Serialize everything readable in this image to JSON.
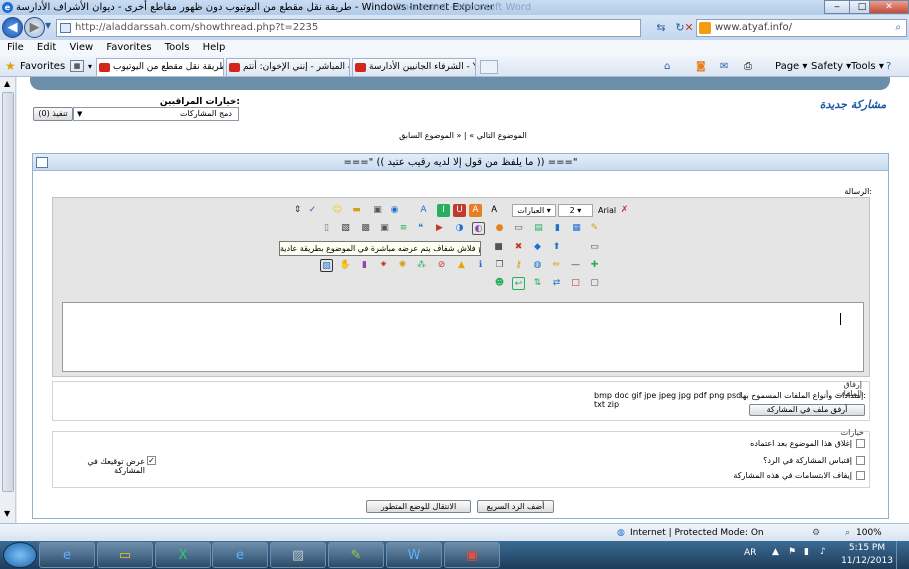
{
  "window": {
    "title": "طريقة نقل مقطع من اليوتيوب دون ظهور مقاطع أخرى - ديوان الأشراف الأدارسة - Windows Internet Explorer",
    "ghost_title": "Document - Microsoft Word",
    "min_label": "‒",
    "max_label": "□",
    "close_label": "✕"
  },
  "address": {
    "url": "http://aladdarssah.com/showthread.php?t=2235",
    "search_text": "www.atyaf.info/"
  },
  "menu": [
    "File",
    "Edit",
    "View",
    "Favorites",
    "Tools",
    "Help"
  ],
  "favorites": {
    "label": "Favorites",
    "tabs": [
      "طريقة نقل مقطع من اليوتيوب ...",
      "البث المباشر - إنني الإخوان: أنتم ...",
      "الشرفاء الجانيين الأدارسة - Y..."
    ],
    "commands": [
      "Page ▾",
      "Safety ▾",
      "Tools ▾"
    ]
  },
  "page": {
    "moderator_label": "خيارات المراقبين:",
    "moderator_select": "دمج المشاركات",
    "exec_button": "(0) تنفيذ",
    "logo_text": "مشاركة جديدة",
    "nav_prev": "« الموضوع السابق",
    "nav_separator": "|",
    "nav_next": "الموضوع التالي »",
    "thread_title": "===\" (( ما يلفظ من قول إلا لديه رقيب عتيد )) ===\"",
    "message_label": "الرسالة:",
    "font_name": "Arial",
    "font_size": "2",
    "phrases": "العبارات",
    "tooltip": "لإدراج فلاش شفاف يتم عرضه مباشرة في الموضوع بطريقة عادية",
    "attach_title": "إرفاق الملفات",
    "attach_label": "إمتدادات وأنواع الملفات المسموح بها:",
    "attach_ext": "bmp doc gif jpe jpeg jpg pdf png psd txt zip",
    "attach_button": "أرفق ملف في المشاركة",
    "options_title": "خيارات",
    "options": [
      {
        "label": "إغلاق هذا الموضوع بعد اعتماده",
        "checked": false
      },
      {
        "label": "إقتباس المشاركة في الرد؟",
        "checked": false
      },
      {
        "label": "إيقاف الابتسامات في هذه المشاركة",
        "checked": false
      }
    ],
    "signature_option": {
      "label": "عرض توقيعك في المشاركة",
      "checked": true
    },
    "quick_reply_button": "أضف الرد السريع",
    "advanced_button": "الانتقال للوضع المتطور"
  },
  "statusbar": {
    "zone": "Internet | Protected Mode: On",
    "zoom": "100%"
  },
  "taskbar": {
    "lang": "AR",
    "time": "5:15 PM",
    "date": "11/12/2013"
  },
  "colors": {
    "accent": "#1d6fd1",
    "panel_border": "#8fb0cf",
    "band": "#6b8fa8"
  }
}
